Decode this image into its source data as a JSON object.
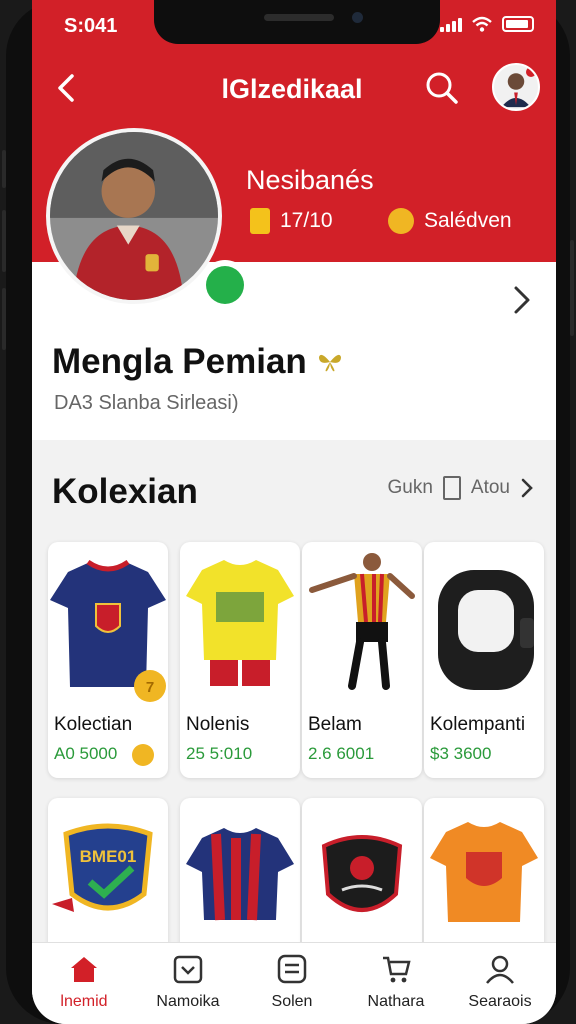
{
  "status_bar": {
    "time": "S:041",
    "signal_icon": "signal-icon",
    "wifi_icon": "wifi-icon",
    "battery_icon": "battery-icon"
  },
  "header": {
    "title": "lGlzedikaal",
    "back_icon": "chevron-left-icon",
    "search_icon": "search-icon",
    "color": "#d22028"
  },
  "profile": {
    "name": "Nesibanés",
    "stat_a": "17/10",
    "stat_b": "Salédven",
    "status_badge_color": "#24b04a"
  },
  "section": {
    "title": "Mengla Pemian",
    "subtitle": "DA3 Slanba Sirleasi)"
  },
  "collection": {
    "title": "Kolexian",
    "see_all_a": "Gukn",
    "see_all_b": "Atou",
    "items": [
      {
        "name": "Kolectian",
        "price": "A0 5000",
        "art": "jersey-navy"
      },
      {
        "name": "Nolenis",
        "price": "25 5:010",
        "art": "jersey-yellow"
      },
      {
        "name": "Belam",
        "price": "2.6 6001",
        "art": "player-figure"
      },
      {
        "name": "Kolempanti",
        "price": "$3 3600",
        "art": "black-band"
      },
      {
        "name": "",
        "price": "",
        "art": "badge-shield",
        "badge_text": "BME01"
      },
      {
        "name": "",
        "price": "",
        "art": "jersey-red-navy"
      },
      {
        "name": "",
        "price": "",
        "art": "black-crest"
      },
      {
        "name": "",
        "price": "",
        "art": "jersey-orange"
      }
    ]
  },
  "bottom_nav": [
    {
      "label": "lnemid",
      "icon": "home-icon",
      "active": true
    },
    {
      "label": "Namoika",
      "icon": "calendar-icon",
      "active": false
    },
    {
      "label": "Solen",
      "icon": "list-icon",
      "active": false
    },
    {
      "label": "Nathara",
      "icon": "cart-icon",
      "active": false
    },
    {
      "label": "Searaois",
      "icon": "user-icon",
      "active": false
    }
  ]
}
